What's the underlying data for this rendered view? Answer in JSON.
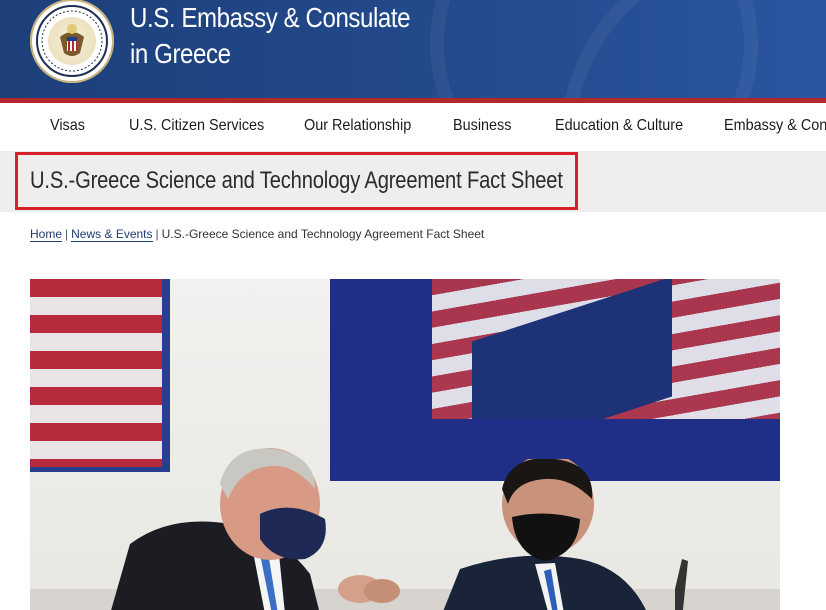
{
  "header": {
    "title_line1": "U.S. Embassy & Consulate",
    "title_line2": "in Greece",
    "seal_icon": "great-seal-icon"
  },
  "nav": {
    "items": [
      {
        "label": "Visas"
      },
      {
        "label": "U.S. Citizen Services"
      },
      {
        "label": "Our Relationship"
      },
      {
        "label": "Business"
      },
      {
        "label": "Education & Culture"
      },
      {
        "label": "Embassy & Cons"
      }
    ]
  },
  "page": {
    "title": "U.S.-Greece Science and Technology Agreement Fact Sheet"
  },
  "breadcrumb": {
    "home": "Home",
    "separator": "|",
    "news": "News & Events",
    "current": "U.S.-Greece Science and Technology Agreement Fact Sheet"
  },
  "colors": {
    "header_blue": "#234a8c",
    "accent_red": "#b3282d",
    "highlight_red": "#d72027",
    "link_blue": "#1f3c73"
  }
}
